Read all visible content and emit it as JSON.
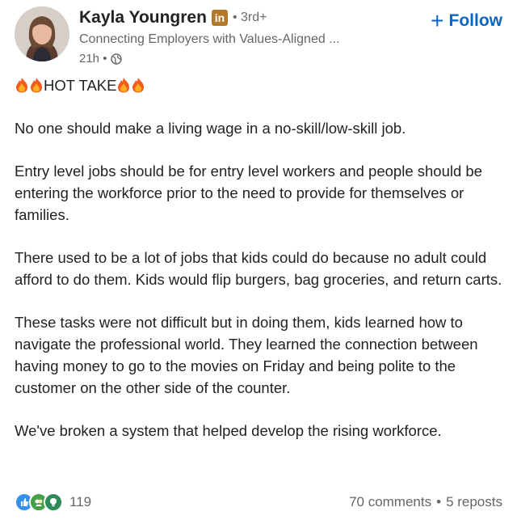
{
  "post": {
    "author": {
      "name": "Kayla Youngren",
      "badge": "in",
      "degree": "• 3rd+",
      "headline": "Connecting Employers with Values-Aligned ...",
      "time": "21h •"
    },
    "follow_label": "Follow",
    "hot_take_label": "HOT TAKE",
    "paragraphs": [
      "No one should make a living wage in a no-skill/low-skill job.",
      "Entry level jobs should be for entry level workers and people should be entering the workforce prior to the need to provide for themselves or families.",
      "There used to be a lot of jobs that kids could do because no adult could afford to do them. Kids would flip burgers, bag groceries, and return carts.",
      "These tasks were not difficult but in doing them, kids learned how to navigate the professional world. They learned the connection between having money to go to the movies on Friday and being polite to the customer on the other side of the counter.",
      "We've broken a system that helped develop the rising workforce."
    ],
    "reactions": {
      "icons": [
        "like-icon",
        "celebrate-icon",
        "insightful-icon"
      ],
      "count": "119"
    },
    "comments": "70 comments",
    "separator": "•",
    "reposts": "5 reposts"
  },
  "colors": {
    "accent": "#0a66c2",
    "badge": "#b07a2a",
    "muted": "#666666"
  }
}
